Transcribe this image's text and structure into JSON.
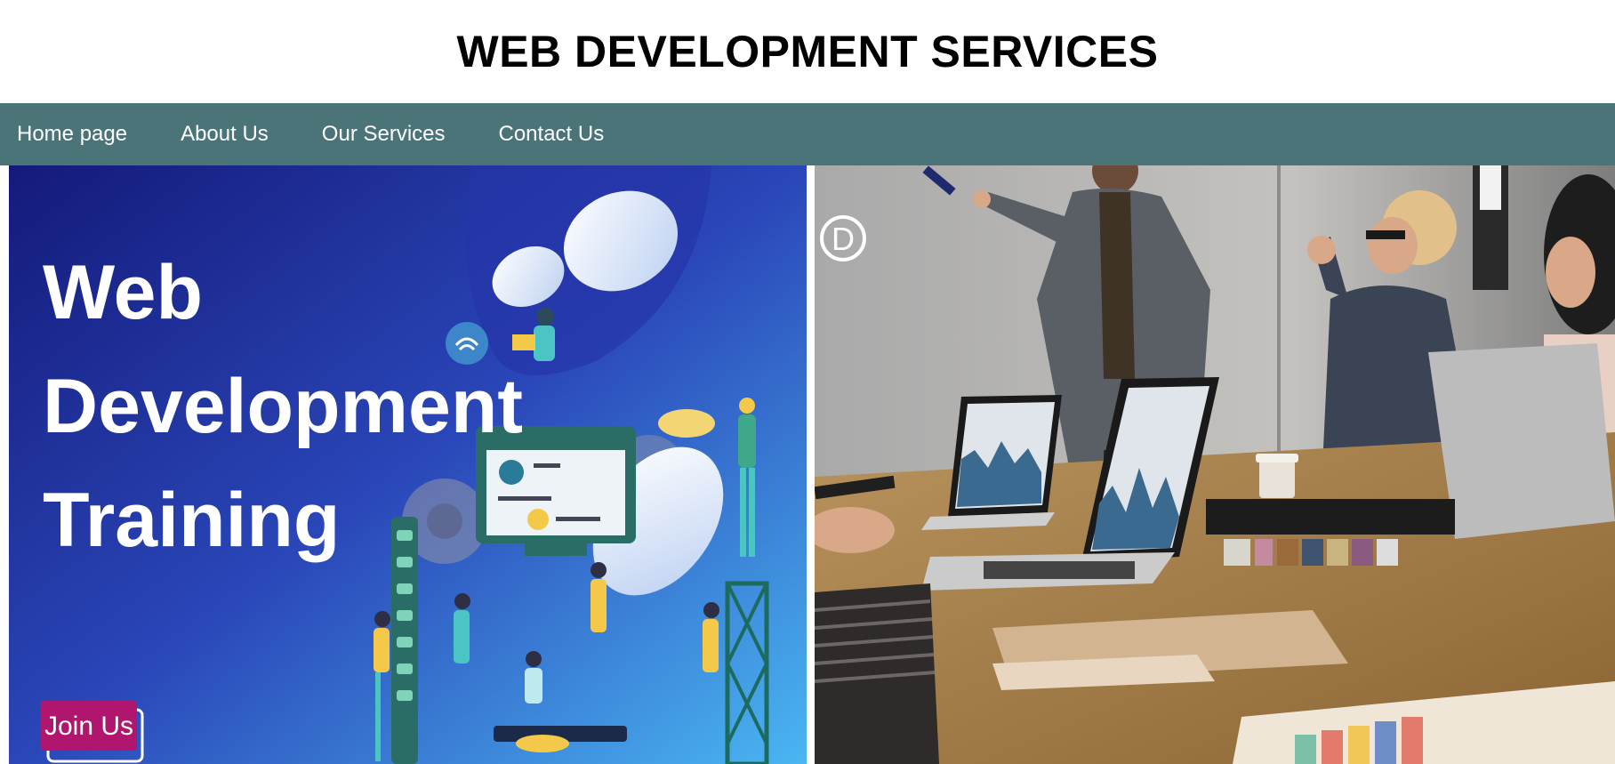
{
  "header": {
    "title": "WEB DEVELOPMENT SERVICES"
  },
  "nav": {
    "items": [
      {
        "label": "Home page"
      },
      {
        "label": "About Us"
      },
      {
        "label": "Our Services"
      },
      {
        "label": "Contact Us"
      }
    ]
  },
  "banner_left": {
    "headline": [
      "Web",
      "Development",
      "Training"
    ],
    "cta_label": "Join Us"
  },
  "banner_right": {
    "logo_letter": "D"
  },
  "colors": {
    "nav_bg": "#4b7478",
    "nav_text": "#ffffff",
    "banner_bg_dark": "#1a237e",
    "banner_bg_light": "#4ab0ef",
    "cta_bg": "#b0166e"
  }
}
